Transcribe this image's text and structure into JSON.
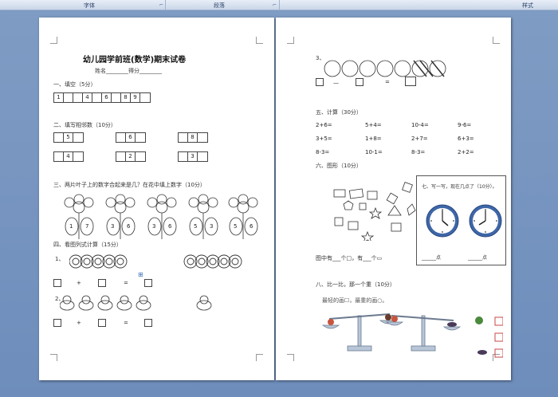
{
  "ribbon": {
    "font_group": "字体",
    "paragraph_group": "段落",
    "styles_group": "样式"
  },
  "page1": {
    "title": "幼儿园学前班(数学)期末试卷",
    "name_score": "姓名________得分________",
    "sec1": "一、填空（5分）",
    "sec1_numbers": [
      "1",
      "4",
      "6",
      "8",
      "9"
    ],
    "sec2": "二、填写相邻数（10分）",
    "sec2_numbers": [
      "5",
      "6",
      "8",
      "4",
      "2",
      "3"
    ],
    "sec3": "三、两片叶子上的数字合起来是几？在花中填上数字（10分）",
    "flower_pairs": [
      [
        "1",
        "7"
      ],
      [
        "3",
        "6"
      ],
      [
        "3",
        "6"
      ],
      [
        "5",
        "3"
      ],
      [
        "5",
        "6"
      ]
    ],
    "sec4": "四、看图列式计算（15分）",
    "q1": "1、",
    "q2": "2、",
    "plus": "+",
    "equals": "="
  },
  "page2": {
    "q3": "3、",
    "minus": "—",
    "equals": "=",
    "sec5": "五、计算（30分）",
    "calc": [
      [
        "2+6=",
        "5+4=",
        "10-4=",
        "9-6="
      ],
      [
        "3+5=",
        "1+8=",
        "2+7=",
        "6+3="
      ],
      [
        "8-3=",
        "10-1=",
        "8-3=",
        "2+2="
      ]
    ],
    "sec6": "六、图形（10分）",
    "sec7": "七、写一写，现在几点了（10分）。",
    "clock_blank_1": "______点",
    "clock_blank_2": "______点",
    "shape_count": "图中有___个□，有___个▭",
    "sec8": "八、比一比，那一个重（10分）",
    "lighter": "最轻的画☐，最重的画○。"
  }
}
